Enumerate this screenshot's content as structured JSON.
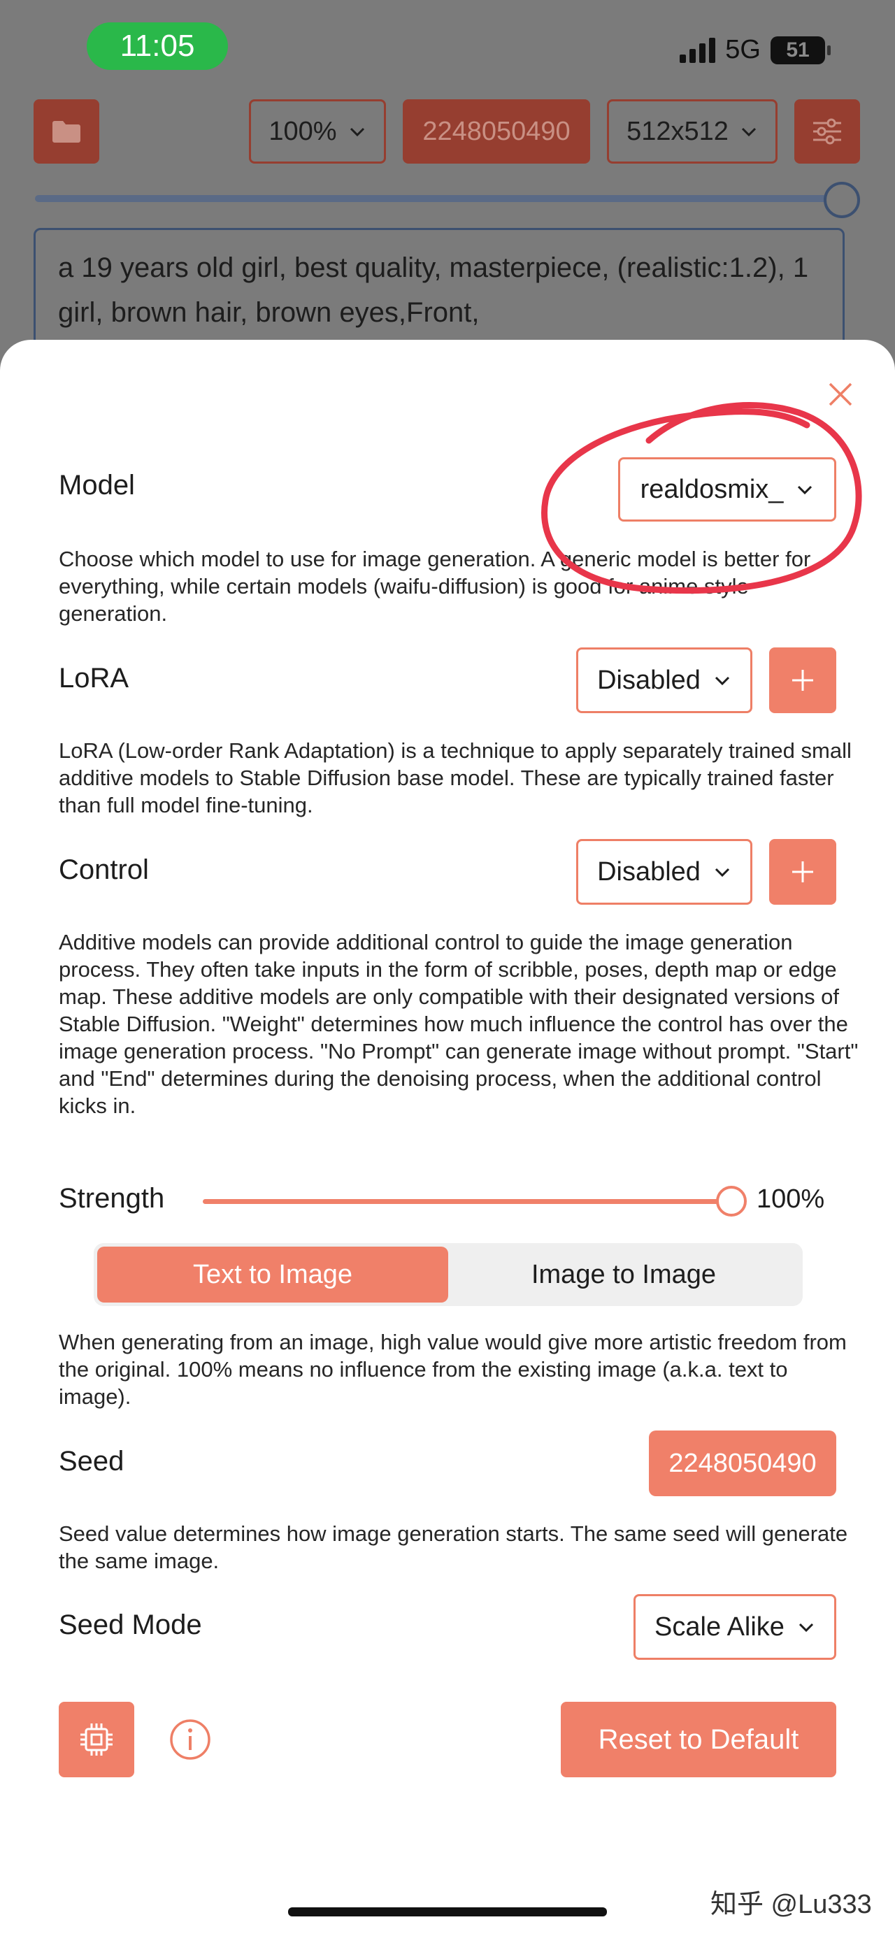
{
  "status_bar": {
    "time": "11:05",
    "network": "5G",
    "battery": "51"
  },
  "toolbar": {
    "folder_icon": "folder-icon",
    "zoom_value": "100%",
    "seed_value": "2248050490",
    "size_value": "512x512",
    "settings_icon": "sliders-icon",
    "progress_fraction": 0.98
  },
  "prompt": {
    "text": "a 19 years old girl, best quality, masterpiece, (realistic:1.2), 1 girl, brown hair, brown eyes,Front,"
  },
  "sheet": {
    "model": {
      "label": "Model",
      "value": "realdosmix_",
      "description": "Choose which model to use for image generation. A generic model is better for everything, while certain models (waifu-diffusion) is good for anime style generation."
    },
    "lora": {
      "label": "LoRA",
      "value": "Disabled",
      "description": "LoRA (Low-order Rank Adaptation) is a technique to apply separately trained small additive models to Stable Diffusion base model. These are typically trained faster than full model fine-tuning."
    },
    "control": {
      "label": "Control",
      "value": "Disabled",
      "description": "Additive models can provide additional control to guide the image generation process. They often take inputs in the form of scribble, poses, depth map or edge map. These additive models are only compatible with their designated versions of Stable Diffusion. \"Weight\" determines how much influence the control has over the image generation process. \"No Prompt\" can generate image without prompt. \"Start\" and \"End\" determines during the denoising process, when the additional control kicks in."
    },
    "strength": {
      "label": "Strength",
      "value_text": "100%",
      "fraction": 1.0
    },
    "mode_tabs": [
      "Text to Image",
      "Image to Image"
    ],
    "mode_description": "When generating from an image, high value would give more artistic freedom from the original. 100% means no influence from the existing image (a.k.a. text to image).",
    "seed": {
      "label": "Seed",
      "value": "2248050490",
      "description": "Seed value determines how image generation starts. The same seed will generate the same image."
    },
    "seed_mode": {
      "label": "Seed Mode",
      "value": "Scale Alike"
    },
    "reset_label": "Reset to Default"
  },
  "watermark": "知乎 @Lu333",
  "colors": {
    "accent": "#f08069",
    "annotation": "#e8364a"
  }
}
